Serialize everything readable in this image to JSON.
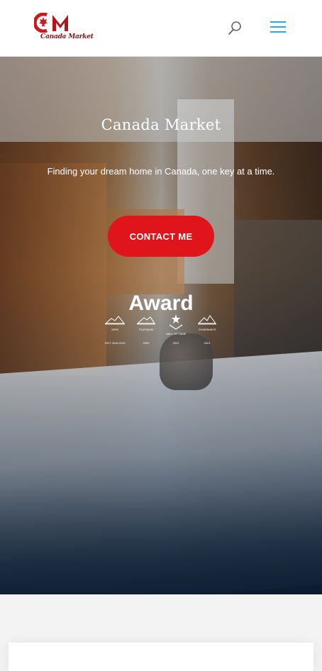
{
  "header": {
    "logo_text": "Canada Market",
    "logo_mark": "CM",
    "brand_color": "#c61b1f",
    "search_icon": "search-icon",
    "menu_icon": "hamburger-menu-icon",
    "menu_color": "#2ea3f2"
  },
  "hero": {
    "title": "Canada Market",
    "subtitle": "Finding your dream home in Canada, one key at a time.",
    "cta_label": "CONTACT ME",
    "cta_color": "#e0151b",
    "award_title": "Award",
    "badges": [
      {
        "icon": "100-percent-club-award-icon",
        "label": "100%",
        "sub": "2017 2018 2019"
      },
      {
        "icon": "platinum-award-icon",
        "label": "PLATINUM",
        "sub": "2020"
      },
      {
        "icon": "hall-of-fame-award-icon",
        "label": "HALL OF FAME",
        "sub": "2021"
      },
      {
        "icon": "chairmans-award-icon",
        "label": "CHAIRMAN'S",
        "sub": "2021"
      }
    ]
  }
}
